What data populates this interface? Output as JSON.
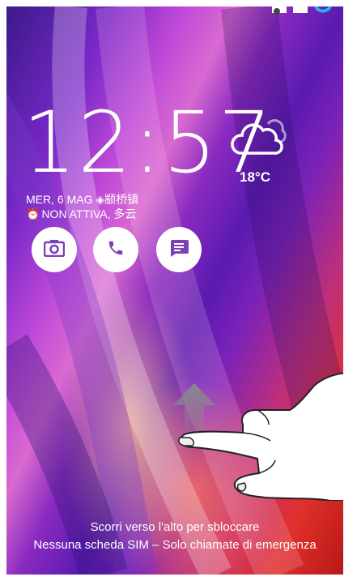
{
  "lockscreen": {
    "time": "12:57",
    "temperature": "18°C",
    "date_text": "MER, 6 MAG",
    "location": "颛桥镇",
    "alarm_status": "NON ATTIVA, 多云",
    "unlock_hint": "Scorri verso l'alto per sbloccare",
    "sim_status": "Nessuna scheda SIM – Solo chiamate di emergenza"
  },
  "shortcuts": [
    {
      "icon": "camera-icon"
    },
    {
      "icon": "phone-icon"
    },
    {
      "icon": "message-icon"
    }
  ],
  "colors": {
    "accent": "#7b3fb8",
    "background_purple": "#6a28c0",
    "background_red": "#d8282a"
  }
}
